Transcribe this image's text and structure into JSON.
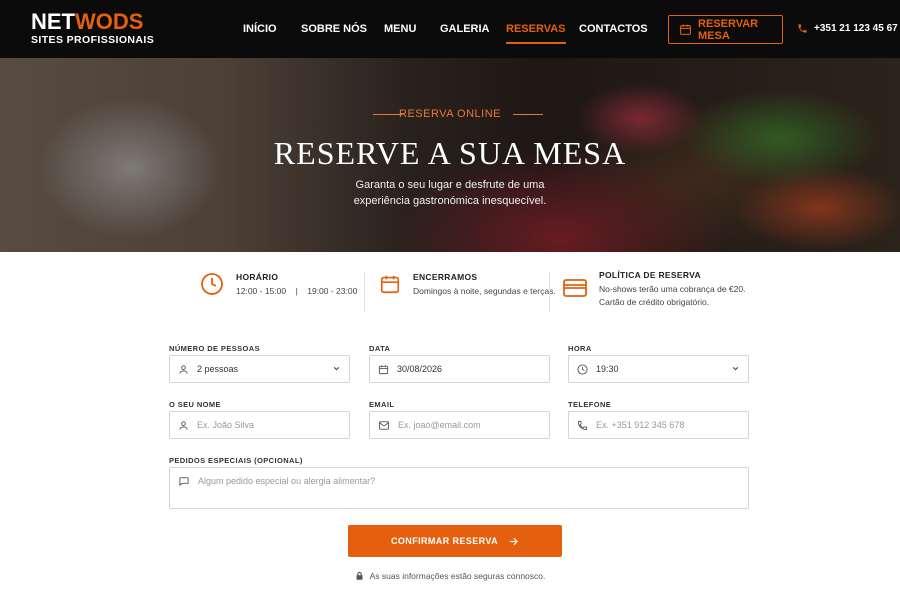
{
  "brand": {
    "name_part1": "NET",
    "name_part2": "WODS",
    "tagline": "SITES PROFISSIONAIS",
    "accent_color": "#e4600f"
  },
  "nav": {
    "items": [
      {
        "label": "INÍCIO"
      },
      {
        "label": "SOBRE NÓS"
      },
      {
        "label": "MENU"
      },
      {
        "label": "GALERIA"
      },
      {
        "label": "RESERVAS",
        "active": true
      },
      {
        "label": "CONTACTOS"
      }
    ],
    "cta_label": "RESERVAR MESA",
    "phone": "+351 21 123 45 67"
  },
  "hero": {
    "kicker": "RESERVA ONLINE",
    "title": "RESERVE A SUA MESA",
    "subtitle": "Garanta o seu lugar e desfrute de uma experiência gastronómica inesquecível."
  },
  "info": {
    "hours": {
      "title": "HORÁRIO",
      "lunch": "12:00 - 15:00",
      "separator": "|",
      "dinner": "19:00 - 23:00",
      "icon": "clock-icon"
    },
    "closed": {
      "title": "ENCERRAMOS",
      "text": "Domingos à noite, segundas e terças.",
      "icon": "calendar-icon"
    },
    "policy": {
      "title": "POLÍTICA DE RESERVA",
      "line1": "No-shows terão uma cobrança de €20.",
      "line2": "Cartão de crédito obrigatório.",
      "icon": "credit-card-icon"
    }
  },
  "form": {
    "guests": {
      "label": "NÚMERO DE PESSOAS",
      "value": "2 pessoas"
    },
    "date": {
      "label": "DATA",
      "value": "30/08/2026"
    },
    "time": {
      "label": "HORA",
      "value": "19:30"
    },
    "name": {
      "label": "O SEU NOME",
      "placeholder": "Ex. João Silva"
    },
    "email": {
      "label": "EMAIL",
      "placeholder": "Ex. joao@email.com"
    },
    "phone": {
      "label": "TELEFONE",
      "placeholder": "Ex. +351 912 345 678"
    },
    "requests": {
      "label": "PEDIDOS ESPECIAIS (OPCIONAL)",
      "placeholder": "Algum pedido especial ou alergia alimentar?"
    },
    "submit_label": "CONFIRMAR RESERVA",
    "secure_note": "As suas informações estão seguras connosco."
  }
}
